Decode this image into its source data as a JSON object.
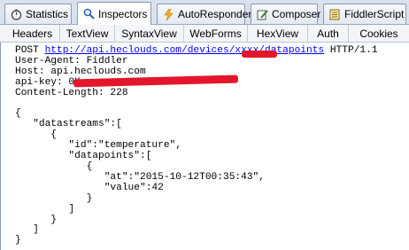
{
  "tabs": [
    {
      "label": "Statistics",
      "icon": "stopwatch-icon"
    },
    {
      "label": "Inspectors",
      "icon": "magnifier-icon",
      "active": true
    },
    {
      "label": "AutoResponder",
      "icon": "lightning-icon"
    },
    {
      "label": "Composer",
      "icon": "pencil-icon"
    },
    {
      "label": "FiddlerScript",
      "icon": "script-icon"
    }
  ],
  "subtabs": [
    "Headers",
    "TextView",
    "SyntaxView",
    "WebForms",
    "HexView",
    "Auth",
    "Cookies"
  ],
  "request": {
    "method": "POST",
    "url_prefix": "http://api.heclouds.com/devices/",
    "url_suffix": "/datapoints",
    "protocol": "HTTP/1.1",
    "headers": [
      "User-Agent: Fiddler",
      "Host: api.heclouds.com",
      "api-key: 0K",
      "Content-Length: 228"
    ],
    "body_lines": [
      "",
      "{",
      "   \"datastreams\":[",
      "      {",
      "         \"id\":\"temperature\",",
      "         \"datapoints\":[",
      "            {",
      "               \"at\":\"2015-10-12T00:35:43\",",
      "               \"value\":42",
      "            }",
      "         ]",
      "      }",
      "   ]",
      "}"
    ]
  },
  "colors": {
    "redaction": "#e4162c",
    "link": "#0000ff"
  }
}
